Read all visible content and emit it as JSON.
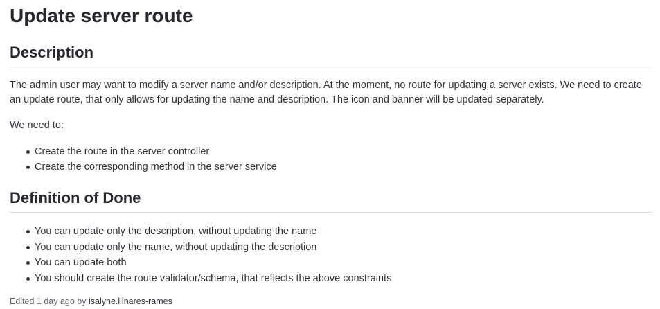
{
  "issue": {
    "title": "Update server route"
  },
  "description_section": {
    "heading": "Description",
    "paragraph": "The admin user may want to modify a server name and/or description. At the moment, no route for updating a server exists. We need to create an update route, that only allows for updating the name and description. The icon and banner will be updated separately.",
    "need_intro": "We need to:",
    "tasks": [
      "Create the route in the server controller",
      "Create the corresponding method in the server service"
    ]
  },
  "definition_of_done": {
    "heading": "Definition of Done",
    "items": [
      "You can update only the description, without updating the name",
      "You can update only the name, without updating the description",
      "You can update both",
      "You should create the route validator/schema, that reflects the above constraints"
    ]
  },
  "edit_info": {
    "prefix": "Edited 1 day ago by",
    "author": "isalyne.llinares-rames"
  }
}
